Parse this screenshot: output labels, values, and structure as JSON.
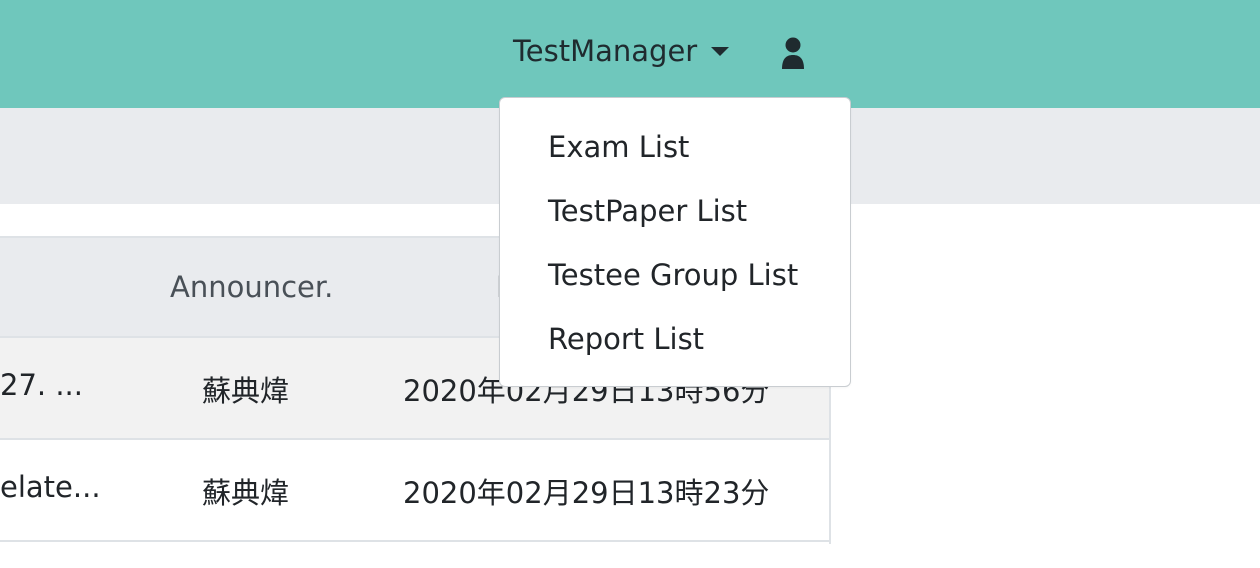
{
  "navbar": {
    "dropdown_label": "TestManager",
    "user_icon": "user-icon",
    "caret_icon": "caret-down-icon",
    "background_color": "#6fc7bc"
  },
  "dropdown": {
    "items": [
      {
        "label": "Exam List"
      },
      {
        "label": "TestPaper List"
      },
      {
        "label": "Testee Group List"
      },
      {
        "label": "Report List"
      }
    ]
  },
  "table": {
    "headers": {
      "announcer": "Announcer.",
      "date": "D"
    },
    "rows": [
      {
        "title": "27. ...",
        "announcer": "蘇典煒",
        "date": "2020年02月29日13時56分"
      },
      {
        "title": "elate...",
        "announcer": "蘇典煒",
        "date": "2020年02月29日13時23分"
      }
    ]
  }
}
